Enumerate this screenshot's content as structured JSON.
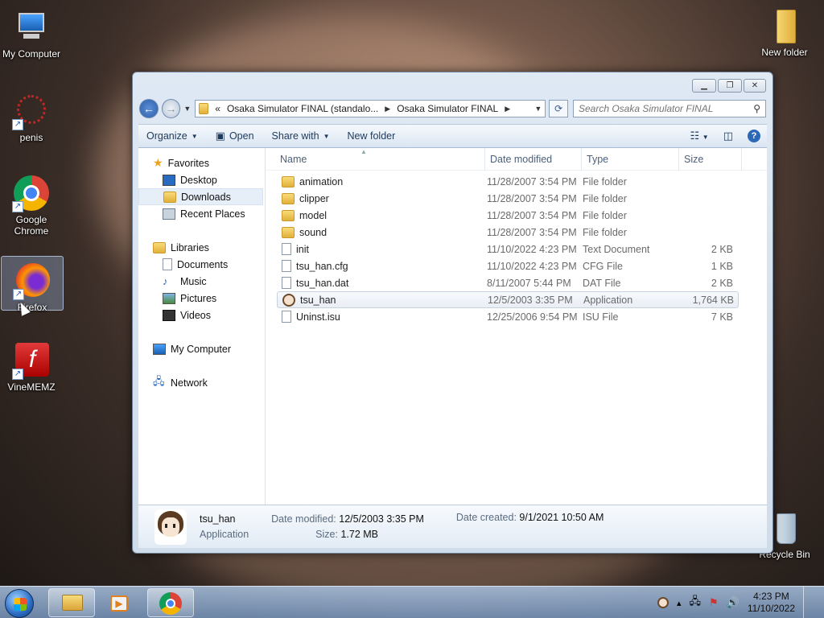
{
  "desktop": {
    "icons": [
      {
        "label": "My Computer",
        "icon": "computer-icon"
      },
      {
        "label": "penis",
        "icon": "red-ornament-icon"
      },
      {
        "label": "Google Chrome",
        "icon": "chrome-icon"
      },
      {
        "label": "Firefox",
        "icon": "firefox-icon"
      },
      {
        "label": "VineMEMZ",
        "icon": "flash-icon"
      },
      {
        "label": "New folder",
        "icon": "folder-icon"
      },
      {
        "label": "Recycle Bin",
        "icon": "recycle-bin-icon"
      }
    ]
  },
  "window": {
    "address": {
      "overflow": "«",
      "crumb1": "Osaka Simulator FINAL (standalo...",
      "crumb2": "Osaka Simulator FINAL"
    },
    "search_placeholder": "Search Osaka Simulator FINAL",
    "toolbar": {
      "organize": "Organize",
      "open": "Open",
      "share_with": "Share with",
      "new_folder": "New folder"
    },
    "nav": {
      "favorites": "Favorites",
      "desktop": "Desktop",
      "downloads": "Downloads",
      "recent": "Recent Places",
      "libraries": "Libraries",
      "documents": "Documents",
      "music": "Music",
      "pictures": "Pictures",
      "videos": "Videos",
      "my_computer": "My Computer",
      "network": "Network"
    },
    "columns": {
      "name": "Name",
      "date": "Date modified",
      "type": "Type",
      "size": "Size"
    },
    "files": [
      {
        "name": "animation",
        "date": "11/28/2007 3:54 PM",
        "type": "File folder",
        "size": ""
      },
      {
        "name": "clipper",
        "date": "11/28/2007 3:54 PM",
        "type": "File folder",
        "size": ""
      },
      {
        "name": "model",
        "date": "11/28/2007 3:54 PM",
        "type": "File folder",
        "size": ""
      },
      {
        "name": "sound",
        "date": "11/28/2007 3:54 PM",
        "type": "File folder",
        "size": ""
      },
      {
        "name": "init",
        "date": "11/10/2022 4:23 PM",
        "type": "Text Document",
        "size": "2 KB"
      },
      {
        "name": "tsu_han.cfg",
        "date": "11/10/2022 4:23 PM",
        "type": "CFG File",
        "size": "1 KB"
      },
      {
        "name": "tsu_han.dat",
        "date": "8/11/2007 5:44 PM",
        "type": "DAT File",
        "size": "2 KB"
      },
      {
        "name": "tsu_han",
        "date": "12/5/2003 3:35 PM",
        "type": "Application",
        "size": "1,764 KB"
      },
      {
        "name": "Uninst.isu",
        "date": "12/25/2006 9:54 PM",
        "type": "ISU File",
        "size": "7 KB"
      }
    ],
    "details": {
      "name": "tsu_han",
      "kind": "Application",
      "date_modified_label": "Date modified:",
      "date_modified": "12/5/2003 3:35 PM",
      "size_label": "Size:",
      "size": "1.72 MB",
      "date_created_label": "Date created:",
      "date_created": "9/1/2021 10:50 AM"
    }
  },
  "taskbar": {
    "time": "4:23 PM",
    "date": "11/10/2022"
  }
}
